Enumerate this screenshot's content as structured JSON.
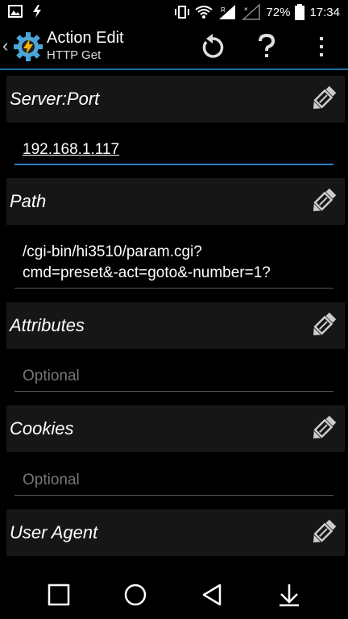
{
  "status_bar": {
    "battery_percent": "72%",
    "time": "17:34",
    "icons": [
      "image-icon",
      "bolt-icon",
      "vibrate-icon",
      "wifi-icon",
      "signal-r-icon",
      "signal-x-icon",
      "battery-icon"
    ]
  },
  "action_bar": {
    "title": "Action Edit",
    "subtitle": "HTTP Get",
    "accent_color": "#1d6fa5"
  },
  "sections": [
    {
      "label": "Server:Port",
      "value": "192.168.1.117",
      "placeholder": ""
    },
    {
      "label": "Path",
      "value_line1": "/cgi-bin/hi3510/param.cgi?",
      "value_line2": "cmd=preset&-act=goto&-number=1?"
    },
    {
      "label": "Attributes",
      "placeholder": "Optional"
    },
    {
      "label": "Cookies",
      "placeholder": "Optional"
    },
    {
      "label": "User Agent"
    }
  ],
  "nav_bar": {
    "icons": [
      "square-recents-icon",
      "circle-home-icon",
      "triangle-back-icon",
      "down-arrow-icon"
    ]
  }
}
